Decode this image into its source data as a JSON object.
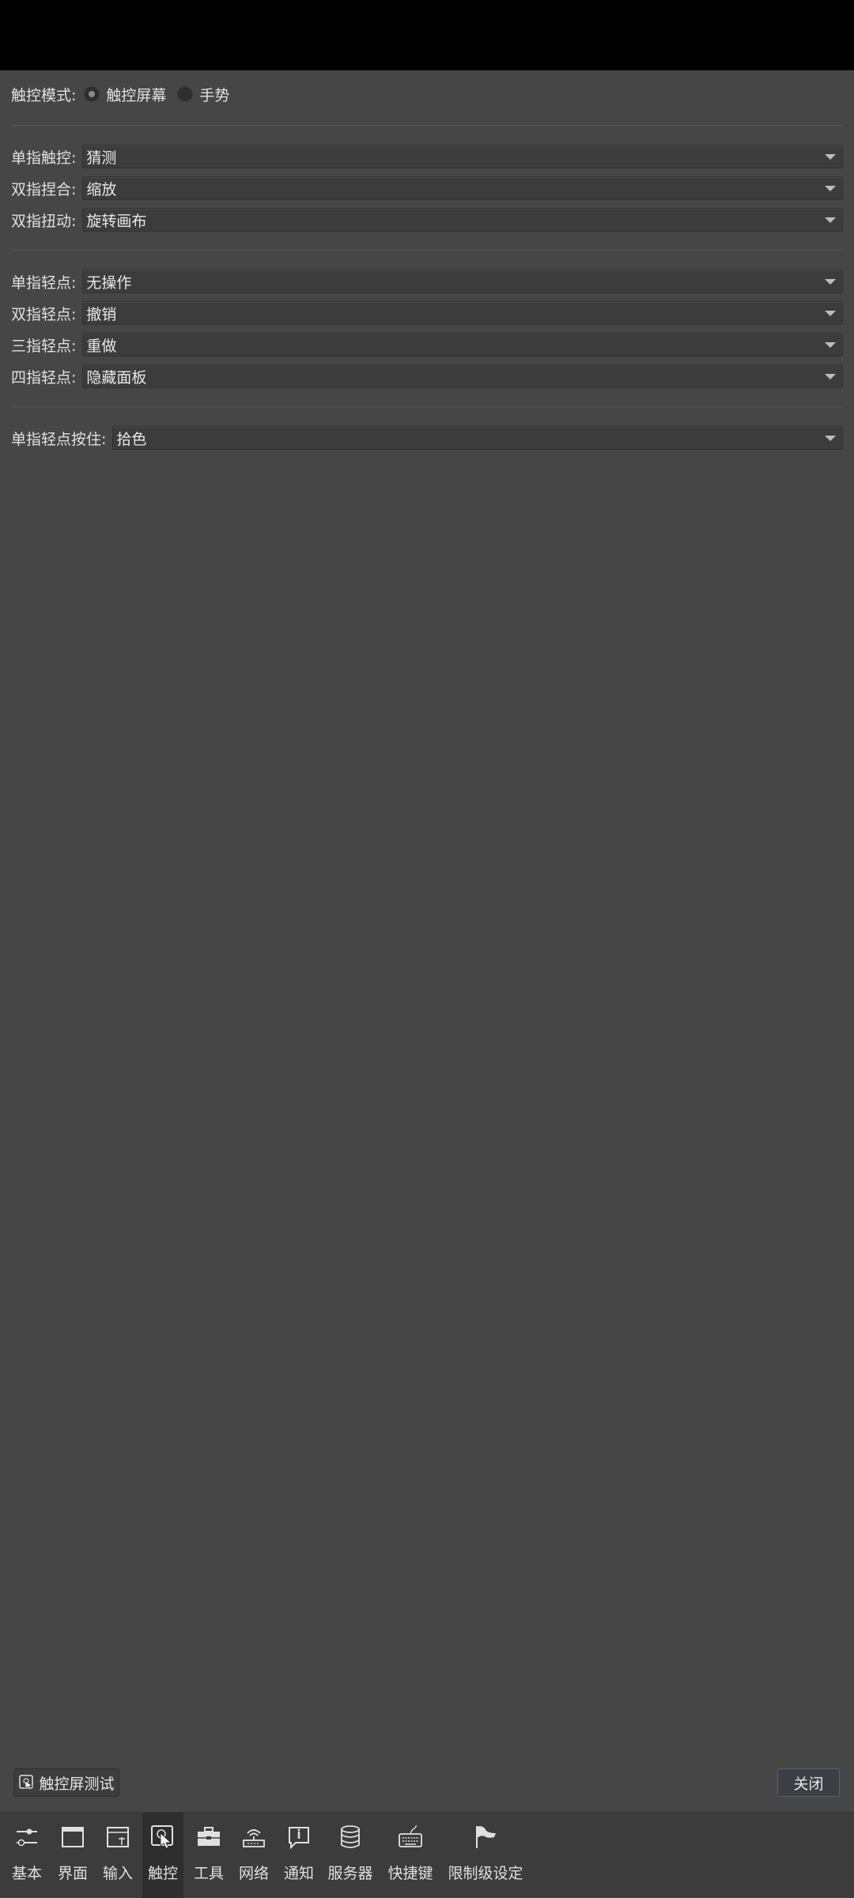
{
  "touch_mode": {
    "label": "触控模式:",
    "options": [
      {
        "label": "触控屏幕",
        "selected": true
      },
      {
        "label": "手势",
        "selected": false
      }
    ]
  },
  "group1": [
    {
      "label": "单指触控:",
      "value": "猜测"
    },
    {
      "label": "双指捏合:",
      "value": "缩放"
    },
    {
      "label": "双指扭动:",
      "value": "旋转画布"
    }
  ],
  "group2": [
    {
      "label": "单指轻点:",
      "value": "无操作"
    },
    {
      "label": "双指轻点:",
      "value": "撤销"
    },
    {
      "label": "三指轻点:",
      "value": "重做"
    },
    {
      "label": "四指轻点:",
      "value": "隐藏面板"
    }
  ],
  "group3": [
    {
      "label": "单指轻点按住:",
      "value": "拾色"
    }
  ],
  "buttons": {
    "touch_test": "触控屏测试",
    "close": "关闭"
  },
  "tabs": [
    {
      "label": "基本",
      "icon": "sliders-icon",
      "active": false
    },
    {
      "label": "界面",
      "icon": "window-icon",
      "active": false
    },
    {
      "label": "输入",
      "icon": "input-window-icon",
      "active": false
    },
    {
      "label": "触控",
      "icon": "touch-icon",
      "active": true
    },
    {
      "label": "工具",
      "icon": "toolbox-icon",
      "active": false
    },
    {
      "label": "网络",
      "icon": "network-icon",
      "active": false
    },
    {
      "label": "通知",
      "icon": "notification-icon",
      "active": false
    },
    {
      "label": "服务器",
      "icon": "database-icon",
      "active": false
    },
    {
      "label": "快捷键",
      "icon": "keyboard-icon",
      "active": false
    },
    {
      "label": "限制级设定",
      "icon": "flag-icon",
      "active": false
    }
  ]
}
